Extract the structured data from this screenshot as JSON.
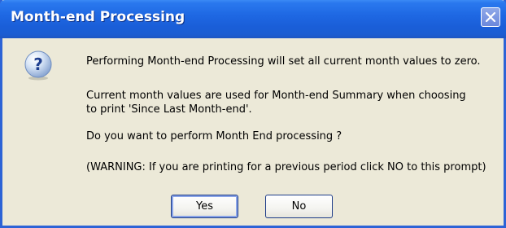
{
  "window": {
    "title": "Month-end Processing"
  },
  "message": {
    "line1": "Performing Month-end Processing will set all current month values to zero.",
    "line2": "Current month values are used for Month-end Summary when choosing",
    "line3": "to print 'Since Last Month-end'.",
    "line4": "Do you want to perform Month End processing ?",
    "line5": "(WARNING: If you are printing for a previous period click NO to this prompt)"
  },
  "buttons": {
    "yes_label": "Yes",
    "no_label": "No"
  },
  "icons": {
    "dialog_icon": "question-icon",
    "close": "close-icon"
  },
  "colors": {
    "titlebar": "#1e68e3",
    "frame": "#2d63d6",
    "background": "#ece9d8"
  }
}
